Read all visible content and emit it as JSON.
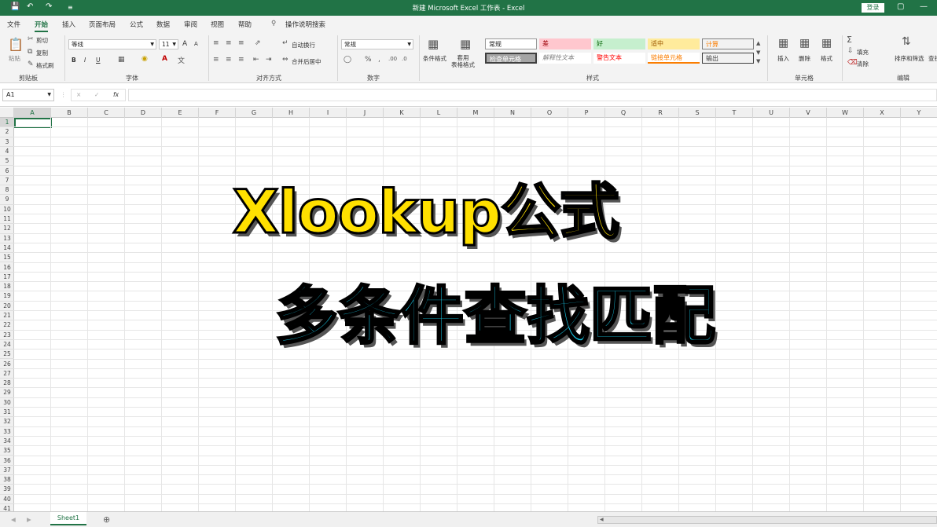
{
  "titlebar": {
    "title": "新建 Microsoft Excel 工作表  -  Excel",
    "login_label": "登录",
    "save_icon": "save-icon",
    "undo_icon": "undo-icon",
    "redo_icon": "redo-icon"
  },
  "tabs": [
    "文件",
    "开始",
    "插入",
    "页面布局",
    "公式",
    "数据",
    "审阅",
    "视图",
    "帮助"
  ],
  "active_tab": "开始",
  "tell_me": "操作说明搜索",
  "ribbon": {
    "clipboard": {
      "paste": "粘贴",
      "cut": "剪切",
      "copy": "复制",
      "format_painter": "格式刷",
      "label": "剪贴板"
    },
    "font": {
      "name": "等线",
      "size": "11",
      "bold": "B",
      "italic": "I",
      "underline": "U",
      "grow": "A",
      "shrink": "A",
      "label": "字体"
    },
    "alignment": {
      "wrap": "自动换行",
      "merge": "合并后居中",
      "label": "对齐方式"
    },
    "number": {
      "format": "常规",
      "label": "数字"
    },
    "styles": {
      "conditional": "条件格式",
      "table_format": "套用\n表格格式",
      "cells": [
        {
          "text": "常规",
          "bg": "#ffffff",
          "color": "#222222"
        },
        {
          "text": "差",
          "bg": "#ffc7ce",
          "color": "#9c0006"
        },
        {
          "text": "好",
          "bg": "#c6efce",
          "color": "#006100"
        },
        {
          "text": "适中",
          "bg": "#ffeb9c",
          "color": "#9c5700"
        },
        {
          "text": "计算",
          "bg": "#f2f2f2",
          "color": "#fa7d00"
        },
        {
          "text": "检查单元格",
          "bg": "#a5a5a5",
          "color": "#ffffff"
        },
        {
          "text": "解释性文本",
          "bg": "#ffffff",
          "color": "#7f7f7f"
        },
        {
          "text": "警告文本",
          "bg": "#ffffff",
          "color": "#ff0000"
        },
        {
          "text": "链接单元格",
          "bg": "#ffffff",
          "color": "#fa7d00"
        },
        {
          "text": "输出",
          "bg": "#f2f2f2",
          "color": "#3f3f3f"
        }
      ],
      "label": "样式"
    },
    "cells_group": {
      "insert": "插入",
      "delete": "删除",
      "format": "格式",
      "label": "单元格"
    },
    "editing": {
      "fill": "填充",
      "clear": "清除",
      "sort_filter": "排序和筛选",
      "find": "查找",
      "label": "编辑"
    }
  },
  "formula_bar": {
    "name_box": "A1",
    "fx": "fx",
    "cancel": "×",
    "enter": "✓",
    "value": ""
  },
  "columns": [
    "A",
    "B",
    "C",
    "D",
    "E",
    "F",
    "G",
    "H",
    "I",
    "J",
    "K",
    "L",
    "M",
    "N",
    "O",
    "P",
    "Q",
    "R",
    "S",
    "T",
    "U",
    "V",
    "W",
    "X",
    "Y"
  ],
  "rows": [
    "1",
    "2",
    "3",
    "4",
    "5",
    "6",
    "7",
    "8",
    "9",
    "10",
    "11",
    "12",
    "13",
    "14",
    "15",
    "16",
    "17",
    "18",
    "19",
    "20",
    "21",
    "22",
    "23",
    "24",
    "25",
    "26",
    "27",
    "28",
    "29",
    "30",
    "31",
    "32",
    "33",
    "34",
    "35",
    "36",
    "37",
    "38",
    "39",
    "40",
    "41"
  ],
  "overlay": {
    "line1": "Xlookup公式",
    "line2": "多条件查找匹配"
  },
  "sheet_tab": "Sheet1",
  "add_sheet": "⊕"
}
